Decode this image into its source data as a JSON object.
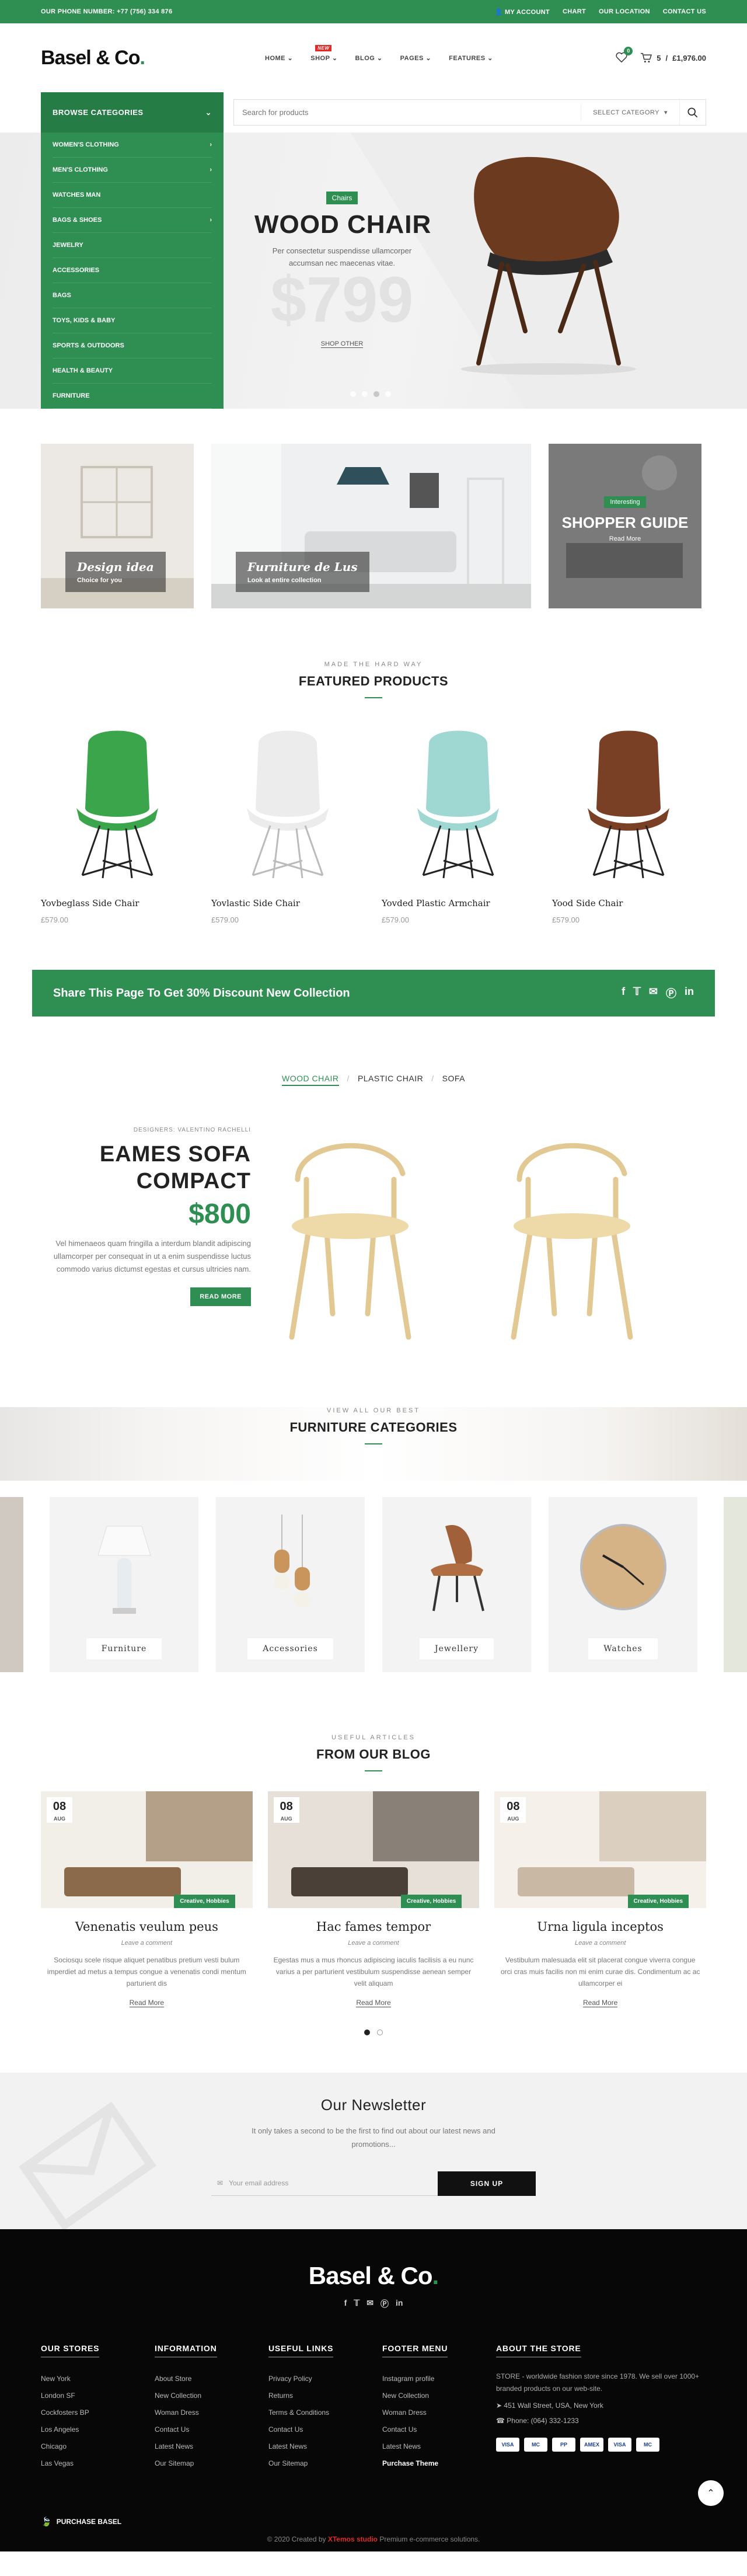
{
  "topbar": {
    "phone": "OUR PHONE NUMBER: +77 (756) 334 876",
    "my_account": "MY ACCOUNT",
    "chart": "CHART",
    "location": "OUR LOCATION",
    "contact": "CONTACT US"
  },
  "header": {
    "logo_text": "Basel & Co",
    "logo_dot": ".",
    "nav": [
      "HOME",
      "SHOP",
      "BLOG",
      "PAGES",
      "FEATURES"
    ],
    "new_badge": "NEW",
    "wishlist_count": "0",
    "cart_count": "5",
    "cart_total": "£1,976.00"
  },
  "categories": {
    "heading": "BROWSE CATEGORIES",
    "items": [
      {
        "label": "WOMEN'S CLOTHING",
        "arrow": true
      },
      {
        "label": "MEN'S CLOTHING",
        "arrow": true
      },
      {
        "label": "WATCHES MAN",
        "arrow": false
      },
      {
        "label": "BAGS & SHOES",
        "arrow": true
      },
      {
        "label": "JEWELRY",
        "arrow": false
      },
      {
        "label": "ACCESSORIES",
        "arrow": false
      },
      {
        "label": "BAGS",
        "arrow": false
      },
      {
        "label": "TOYS, KIDS & BABY",
        "arrow": false
      },
      {
        "label": "SPORTS & OUTDOORS",
        "arrow": false
      },
      {
        "label": "HEALTH & BEAUTY",
        "arrow": false
      },
      {
        "label": "FURNITURE",
        "arrow": false
      }
    ]
  },
  "search": {
    "placeholder": "Search for products",
    "category": "SELECT CATEGORY"
  },
  "hero": {
    "badge": "Chairs",
    "title": "WOOD CHAIR",
    "text": "Per consectetur suspendisse ullamcorper accumsan nec maecenas vitae.",
    "price": "$799",
    "link": "SHOP OTHER"
  },
  "promos": [
    {
      "title": "Design idea",
      "subtitle": "Choice for you"
    },
    {
      "title": "Furniture de Lus",
      "subtitle": "Look at entire collection"
    },
    {
      "badge": "Interesting",
      "title": "SHOPPER GUIDE",
      "subtitle": "Read More"
    }
  ],
  "featured": {
    "subtitle": "MADE THE HARD WAY",
    "title": "FEATURED PRODUCTS",
    "products": [
      {
        "name": "Yovbeglass Side Chair",
        "price": "£579.00",
        "color": "#3aa54a"
      },
      {
        "name": "Yovlastic Side Chair",
        "price": "£579.00",
        "color": "#ececec"
      },
      {
        "name": "Yovded Plastic Armchair",
        "price": "£579.00",
        "color": "#9fd7d3"
      },
      {
        "name": "Yood Side Chair",
        "price": "£579.00",
        "color": "#7a4026"
      }
    ]
  },
  "share": {
    "text": "Share This Page To Get 30% Discount New Collection"
  },
  "tabs": [
    "WOOD CHAIR",
    "PLASTIC CHAIR",
    "SOFA"
  ],
  "sofa": {
    "designer": "DESIGNERS: VALENTINO RACHELLI",
    "title_line1": "EAMES SOFA",
    "title_line2": "COMPACT",
    "price": "$800",
    "text": "Vel himenaeos quam fringilla a interdum blandit adipiscing ullamcorper per consequat in ut a enim suspendisse luctus commodo varius dictumst egestas et cursus ultricies nam.",
    "button": "READ MORE"
  },
  "furniture": {
    "subtitle": "VIEW ALL OUR BEST",
    "title": "FURNITURE CATEGORIES",
    "cards": [
      "Furniture",
      "Accessories",
      "Jewellery",
      "Watches"
    ]
  },
  "blog": {
    "subtitle": "USEFUL ARTICLES",
    "title": "FROM OUR BLOG",
    "posts": [
      {
        "day": "08",
        "month": "AUG",
        "tag": "Creative, Hobbies",
        "title": "Venenatis veulum peus",
        "comment": "Leave a comment",
        "text": "Sociosqu scele risque aliquet penatibus pretium vesti bulum imperdiet ad metus a tempus congue a venenatis condi mentum parturient dis",
        "more": "Read More"
      },
      {
        "day": "08",
        "month": "AUG",
        "tag": "Creative, Hobbies",
        "title": "Hac fames tempor",
        "comment": "Leave a comment",
        "text": "Egestas mus a mus rhoncus adipiscing iaculis facilisis a eu nunc varius a per parturient vestibulum suspendisse aenean semper velit aliquam",
        "more": "Read More"
      },
      {
        "day": "08",
        "month": "AUG",
        "tag": "Creative, Hobbies",
        "title": "Urna ligula inceptos",
        "comment": "Leave a comment",
        "text": "Vestibulum malesuada elit sit placerat congue viverra congue orci cras muis facilis non mi enim curae dis. Condimentum ac ac ullamcorper ei",
        "more": "Read More"
      }
    ]
  },
  "newsletter": {
    "title": "Our Newsletter",
    "text": "It only takes a second to be the first to find out about our latest news and promotions...",
    "placeholder": "Your email address",
    "button": "SIGN UP"
  },
  "footer": {
    "logo_text": "Basel & Co",
    "logo_dot": ".",
    "cols": [
      {
        "title": "OUR STORES",
        "items": [
          "New York",
          "London SF",
          "Cockfosters BP",
          "Los Angeles",
          "Chicago",
          "Las Vegas"
        ]
      },
      {
        "title": "INFORMATION",
        "items": [
          "About Store",
          "New Collection",
          "Woman Dress",
          "Contact Us",
          "Latest News",
          "Our Sitemap"
        ]
      },
      {
        "title": "USEFUL LINKS",
        "items": [
          "Privacy Policy",
          "Returns",
          "Terms & Conditions",
          "Contact Us",
          "Latest News",
          "Our Sitemap"
        ]
      },
      {
        "title": "FOOTER MENU",
        "items": [
          "Instagram profile",
          "New Collection",
          "Woman Dress",
          "Contact Us",
          "Latest News",
          "Purchase Theme"
        ]
      }
    ],
    "about_title": "ABOUT THE STORE",
    "about_text": "STORE - worldwide fashion store since 1978. We sell over 1000+ branded products on our web-site.",
    "address": "451 Wall Street, USA, New York",
    "phone": "Phone: (064) 332-1233",
    "payments": [
      "VISA",
      "MC",
      "PP",
      "AMEX",
      "VISA",
      "MC"
    ],
    "purchase": "PURCHASE BASEL",
    "copy_prefix": "2020 Created by",
    "copy_brand": "XTemos studio",
    "copy_suffix": "Premium e-commerce solutions."
  }
}
